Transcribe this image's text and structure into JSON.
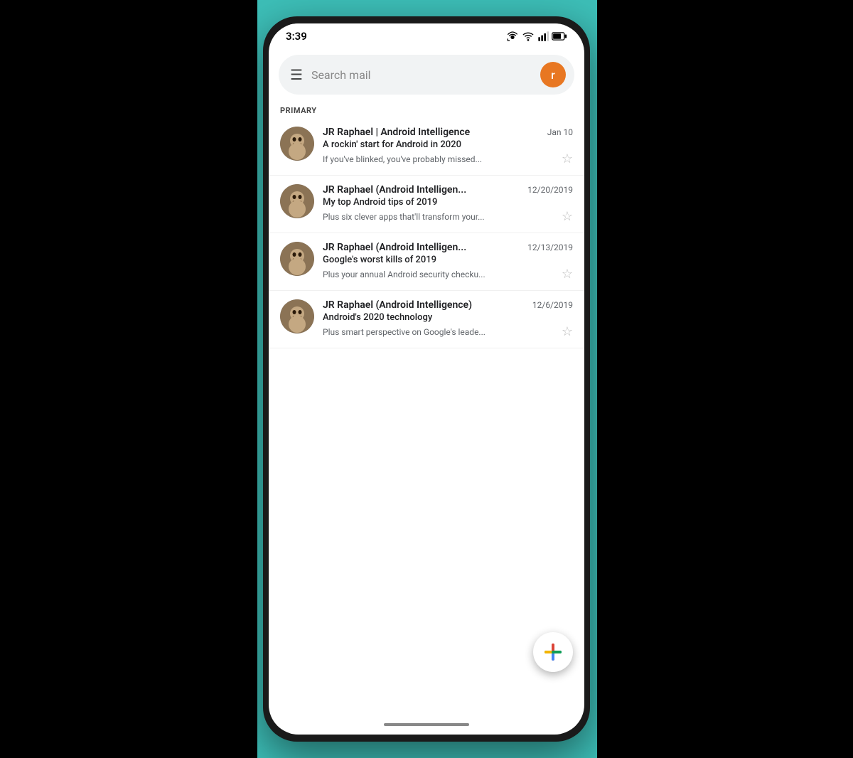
{
  "background": {
    "color": "#3dbfb8"
  },
  "status_bar": {
    "time": "3:39",
    "icons": [
      "cast",
      "wifi",
      "signal",
      "battery"
    ]
  },
  "search_bar": {
    "placeholder": "Search mail",
    "avatar_letter": "r",
    "avatar_color": "#e87722"
  },
  "section": {
    "label": "PRIMARY"
  },
  "emails": [
    {
      "sender": "JR Raphael | Android Intelligence",
      "date": "Jan 10",
      "subject": "A rockin' start for Android in 2020",
      "preview": "If you've blinked, you've probably missed...",
      "starred": false
    },
    {
      "sender": "JR Raphael (Android Intelligen...",
      "date": "12/20/2019",
      "subject": "My top Android tips of 2019",
      "preview": "Plus six clever apps that'll transform your...",
      "starred": false
    },
    {
      "sender": "JR Raphael (Android Intelligen...",
      "date": "12/13/2019",
      "subject": "Google's worst kills of 2019",
      "preview": "Plus your annual Android security checku...",
      "starred": false
    },
    {
      "sender": "JR Raphael (Android Intelligence)",
      "date": "12/6/2019",
      "subject": "Android's 2020 technology",
      "preview": "Plus smart perspective on Google's leade...",
      "starred": false
    }
  ],
  "fab": {
    "label": "Compose",
    "icon": "+"
  },
  "menu_icon": "☰",
  "star_icon": "☆"
}
